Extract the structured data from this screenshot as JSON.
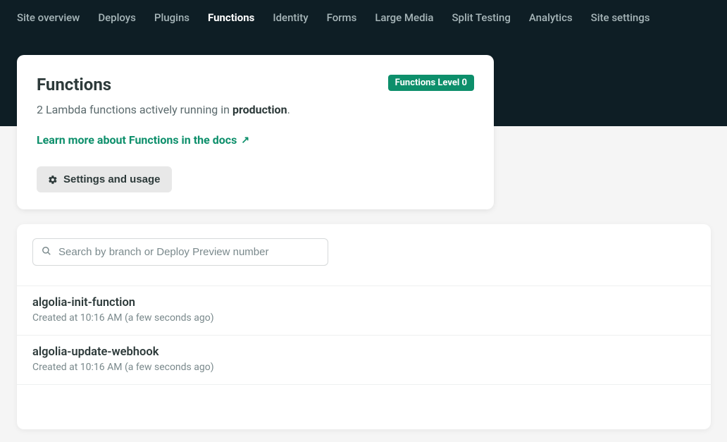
{
  "nav": {
    "tabs": [
      {
        "label": "Site overview",
        "active": false
      },
      {
        "label": "Deploys",
        "active": false
      },
      {
        "label": "Plugins",
        "active": false
      },
      {
        "label": "Functions",
        "active": true
      },
      {
        "label": "Identity",
        "active": false
      },
      {
        "label": "Forms",
        "active": false
      },
      {
        "label": "Large Media",
        "active": false
      },
      {
        "label": "Split Testing",
        "active": false
      },
      {
        "label": "Analytics",
        "active": false
      },
      {
        "label": "Site settings",
        "active": false
      }
    ]
  },
  "hero": {
    "title": "Functions",
    "badge": "Functions Level 0",
    "subtitle_prefix": "2 Lambda functions actively running in ",
    "subtitle_bold": "production",
    "subtitle_suffix": ".",
    "docs_link_label": "Learn more about Functions in the docs",
    "settings_button_label": "Settings and usage"
  },
  "search": {
    "placeholder": "Search by branch or Deploy Preview number"
  },
  "functions": [
    {
      "name": "algolia-init-function",
      "meta": "Created at 10:16 AM (a few seconds ago)"
    },
    {
      "name": "algolia-update-webhook",
      "meta": "Created at 10:16 AM (a few seconds ago)"
    }
  ]
}
